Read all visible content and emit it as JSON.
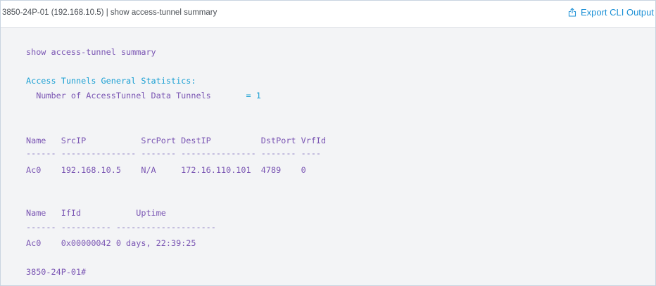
{
  "header": {
    "title": "3850-24P-01 (192.168.10.5) | show access-tunnel summary",
    "export_label": "Export CLI Output",
    "export_icon": "share-icon"
  },
  "console": {
    "command": "show access-tunnel summary",
    "stats_heading": "Access Tunnels General Statistics:",
    "stats_label": "  Number of AccessTunnel Data Tunnels",
    "stats_value": "       = 1",
    "table1": {
      "header": "Name   SrcIP           SrcPort DestIP          DstPort VrfId",
      "separator": "------ --------------- ------- --------------- ------- ----",
      "row": "Ac0    192.168.10.5    N/A     172.16.110.101  4789    0"
    },
    "table2": {
      "header": "Name   IfId           Uptime",
      "separator": "------ ---------- --------------------",
      "row": "Ac0    0x00000042 0 days, 22:39:25"
    },
    "prompt": "3850-24P-01#"
  },
  "colors": {
    "command_text": "#7a55b3",
    "info_text": "#1a9fd3",
    "link": "#1e91d6"
  }
}
